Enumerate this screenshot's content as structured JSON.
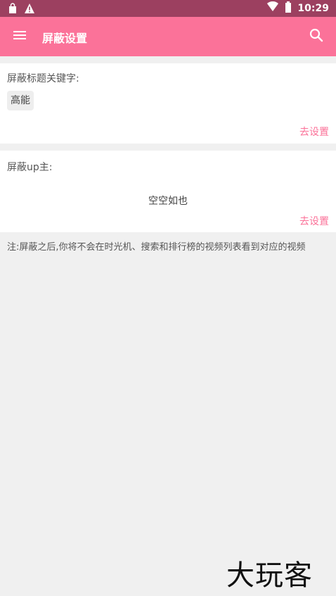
{
  "status_bar": {
    "time": "10:29",
    "icons": [
      "bag-icon",
      "warning-icon",
      "wifi-icon",
      "battery-icon"
    ]
  },
  "app_bar": {
    "title": "屏蔽设置",
    "background_color": "#fb7299",
    "icons": [
      "menu-icon",
      "search-icon"
    ]
  },
  "keyword_section": {
    "label": "屏蔽标题关键字:",
    "chips": [
      "高能"
    ],
    "action": "去设置"
  },
  "up_section": {
    "label": "屏蔽up主:",
    "empty_text": "空空如也",
    "action": "去设置"
  },
  "note": "注:屏蔽之后,你将不会在时光机、搜索和排行榜的视频列表看到对应的视频",
  "watermark_logo": "大玩客"
}
